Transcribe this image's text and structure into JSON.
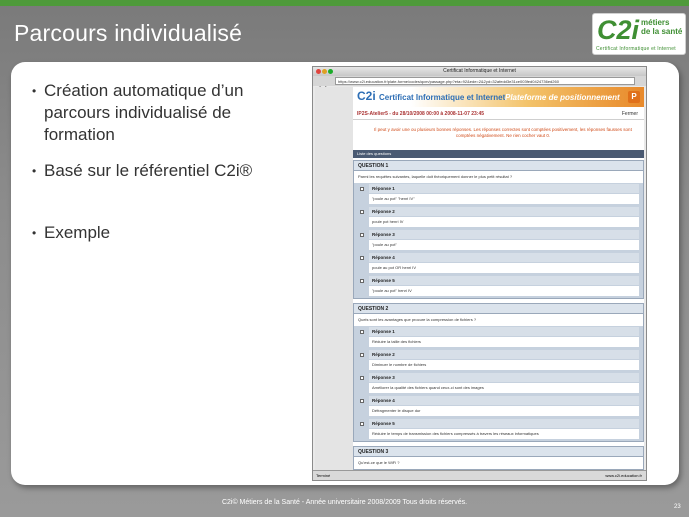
{
  "slide": {
    "title": "Parcours individualisé",
    "page_number": "23",
    "footer": "C2i© Métiers de la Santé - Année universitaire 2008/2009 Tous droits réservés.",
    "accent_color": "#4e9a3a"
  },
  "logo": {
    "mark": "C2i",
    "line1": "métiers",
    "line2": "de la santé",
    "line3": "Certificat Informatique et Internet"
  },
  "bullets": [
    "Création automatique d’un parcours individualisé de formation",
    "Basé sur le référentiel C2i®",
    "Exemple"
  ],
  "browser": {
    "window_title": "Certificat Informatique et Internet",
    "url": "https://www.c2i.education.fr/plate-forme/codes/qcm/passage.php?eta=92&ede=2&2yd=32afedd3e31ce003fed0424736ed260",
    "status_left": "Terminé",
    "status_right": "www.c2i.education.fr"
  },
  "page": {
    "header_logo": "C2i",
    "header_title": "Certificat Informatique et Internet",
    "header_subtitle": "Plateforme de positionnement",
    "header_button": "P",
    "session_title": "IP2S-Atelier5 - du 28/10/2008 00:00 à 2008-11-07 23:45",
    "session_right": "Fermer",
    "notice": "Il peut y avoir une ou plusieurs bonnes réponses. Les réponses correctes sont comptées positivement, les réponses fausses sont comptées négativement. Ne rien cocher vaut 0.",
    "list_header": "Liste des questions"
  },
  "questions": [
    {
      "heading": "QUESTION 1",
      "text": "Parmi les requêtes suivantes, laquelle doit théoriquement donner le plus petit résultat ?",
      "answers": [
        {
          "label": "Réponse 1",
          "value": "\"poule au pot\" \"henri IV\""
        },
        {
          "label": "Réponse 2",
          "value": "poule pot henri IV"
        },
        {
          "label": "Réponse 3",
          "value": "\"poule au pot\""
        },
        {
          "label": "Réponse 4",
          "value": "poule au pot OR henri IV"
        },
        {
          "label": "Réponse 5",
          "value": "\"poule au pot\" henri IV"
        }
      ]
    },
    {
      "heading": "QUESTION 2",
      "text": "Quels sont les avantages que procure la compression de fichiers ?",
      "answers": [
        {
          "label": "Réponse 1",
          "value": "Réduire la taille des fichiers"
        },
        {
          "label": "Réponse 2",
          "value": "Diminuer le nombre de fichiers"
        },
        {
          "label": "Réponse 3",
          "value": "Améliorer la qualité des fichiers quand ceux-ci sont des images"
        },
        {
          "label": "Réponse 4",
          "value": "Défragmenter le disque dur"
        },
        {
          "label": "Réponse 5",
          "value": "Réduire le temps de transmission des fichiers compressés à travers les réseaux informatiques"
        }
      ]
    },
    {
      "heading": "QUESTION 3",
      "text": "Qu'est-ce que le WiFi ?",
      "answers": []
    }
  ]
}
